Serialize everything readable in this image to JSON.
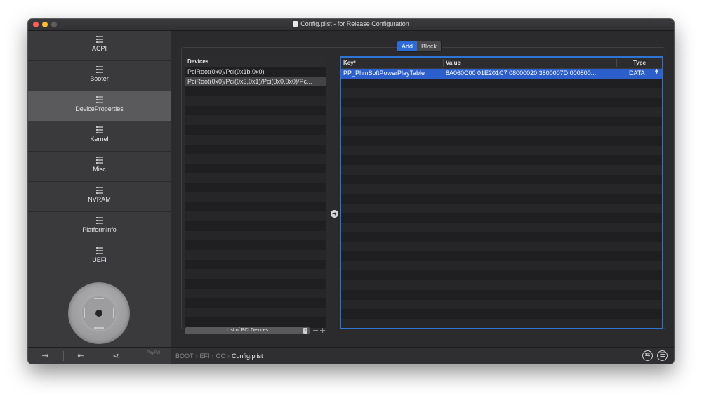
{
  "window": {
    "title": "Config.plist - for Release Configuration"
  },
  "sidebar": {
    "items": [
      {
        "label": "ACPI",
        "icon": "list-icon"
      },
      {
        "label": "Booter",
        "icon": "list-icon"
      },
      {
        "label": "DeviceProperties",
        "icon": "list-icon",
        "selected": true
      },
      {
        "label": "Kernel",
        "icon": "list-icon"
      },
      {
        "label": "Misc",
        "icon": "list-icon"
      },
      {
        "label": "NVRAM",
        "icon": "list-icon"
      },
      {
        "label": "PlatformInfo",
        "icon": "list-icon"
      },
      {
        "label": "UEFI",
        "icon": "list-icon"
      }
    ],
    "footer_icons": [
      "import-icon",
      "export-icon",
      "share-icon"
    ],
    "footer_faint_text": "PayPal"
  },
  "segmented": {
    "add": "Add",
    "block": "Block",
    "selected": "Add"
  },
  "devices": {
    "header": "Devices",
    "rows": [
      "PciRoot(0x0)/Pci(0x1b,0x0)",
      "PciRoot(0x0)/Pci(0x3,0x1)/Pci(0x0,0x0)/Pc..."
    ],
    "selected_index": 1,
    "list_select": "List of PCI Devices",
    "minus": "−",
    "plus": "+"
  },
  "properties": {
    "headers": {
      "key": "Key*",
      "value": "Value",
      "type": "Type"
    },
    "rows": [
      {
        "key": "PP_PhmSoftPowerPlayTable",
        "value": "8A060C00 01E201C7 08000020 3800007D 000800...",
        "type": "DATA"
      }
    ],
    "minus": "−",
    "plus": "+"
  },
  "breadcrumb": {
    "items": [
      "BOOT",
      "EFI",
      "OC",
      "Config.plist"
    ],
    "separator": "›"
  },
  "colors": {
    "accent": "#2d74d6",
    "selection": "#2d5fcc",
    "close": "#ff5f57",
    "minimize": "#febc2e"
  }
}
